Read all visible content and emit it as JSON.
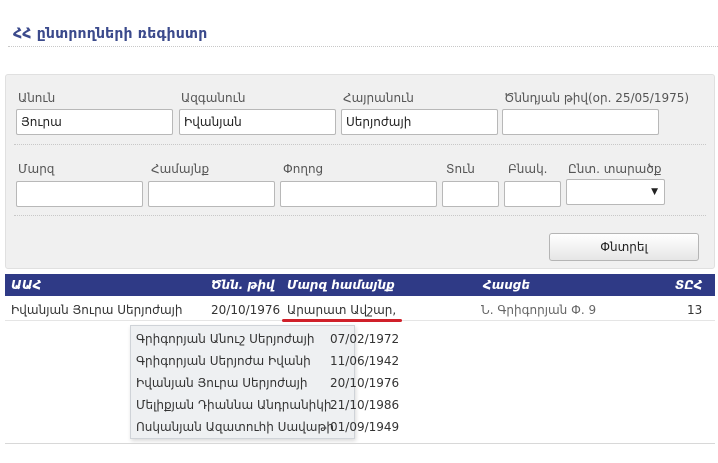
{
  "page": {
    "title": "ՀՀ ընտրողների ռեգիստր"
  },
  "form": {
    "first_name": {
      "label": "Անուն",
      "value": "Յուրա"
    },
    "last_name": {
      "label": "Ազգանուն",
      "value": "Իվանյան"
    },
    "patronymic": {
      "label": "Հայրանուն",
      "value": "Սերյոժայի"
    },
    "birth_date": {
      "label": "Ծննդյան թիվ(օր. 25/05/1975)",
      "value": ""
    },
    "region": {
      "label": "Մարզ",
      "value": ""
    },
    "community": {
      "label": "Համայնք",
      "value": ""
    },
    "street": {
      "label": "Փողոց",
      "value": ""
    },
    "house": {
      "label": "Տուն",
      "value": ""
    },
    "apartment": {
      "label": "Բնակ.",
      "value": ""
    },
    "district": {
      "label": "Ընտ. տարածք",
      "value": ""
    },
    "search_button": "Փնտրել"
  },
  "results": {
    "headers": {
      "name": "ԱԱՀ",
      "birth": "Ծնն. թիվ",
      "region": "Մարզ համայնք",
      "address": "Հասցե",
      "district": "ՏԸՀ"
    },
    "rows": [
      {
        "name": "Իվանյան Յուրա Սերյոժայի",
        "birth": "20/10/1976",
        "region": "Արարատ Ավշար,",
        "address": "Ն. Գրիգորյան Փ. 9",
        "district": "13"
      }
    ]
  },
  "suggestions": [
    {
      "name": "Գրիգորյան Անուշ Սերյոժայի",
      "date": "07/02/1972"
    },
    {
      "name": "Գրիգորյան Սերյոժա Իվանի",
      "date": "11/06/1942"
    },
    {
      "name": "Իվանյան Յուրա Սերյոժայի",
      "date": "20/10/1976"
    },
    {
      "name": "Մելիքյան Դիաննա Անդրանիկի",
      "date": "21/10/1986"
    },
    {
      "name": "Ոսկանյան Ազատուհի Սավաթի",
      "date": "01/09/1949"
    }
  ],
  "colors": {
    "accent": "#2f3a86",
    "title": "#3b4a8c",
    "highlight": "#d0202a"
  },
  "icons": {
    "dropdown": "chevron-down-icon"
  }
}
